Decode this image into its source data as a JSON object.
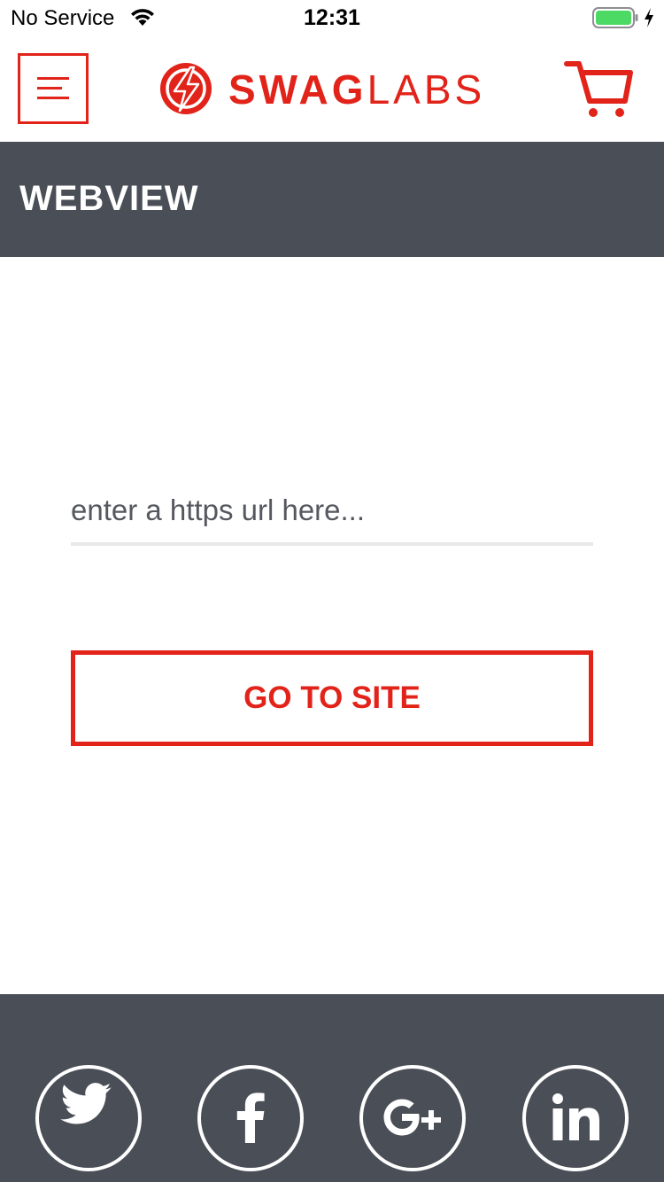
{
  "status_bar": {
    "carrier": "No Service",
    "time": "12:31",
    "icons": [
      "wifi-icon",
      "battery-icon",
      "charging-icon"
    ]
  },
  "header": {
    "menu_icon": "hamburger-menu-icon",
    "logo_bold": "SWAG",
    "logo_light": "LABS",
    "cart_icon": "cart-icon"
  },
  "page": {
    "title": "WEBVIEW"
  },
  "form": {
    "url_placeholder": "enter a https url here...",
    "url_value": "",
    "go_button": "GO TO SITE"
  },
  "footer": {
    "social": [
      "twitter-icon",
      "facebook-icon",
      "google-plus-icon",
      "linkedin-icon"
    ]
  },
  "colors": {
    "brand_red": "#e2231a",
    "band_gray": "#4a4e57",
    "battery_green": "#4cd964"
  }
}
